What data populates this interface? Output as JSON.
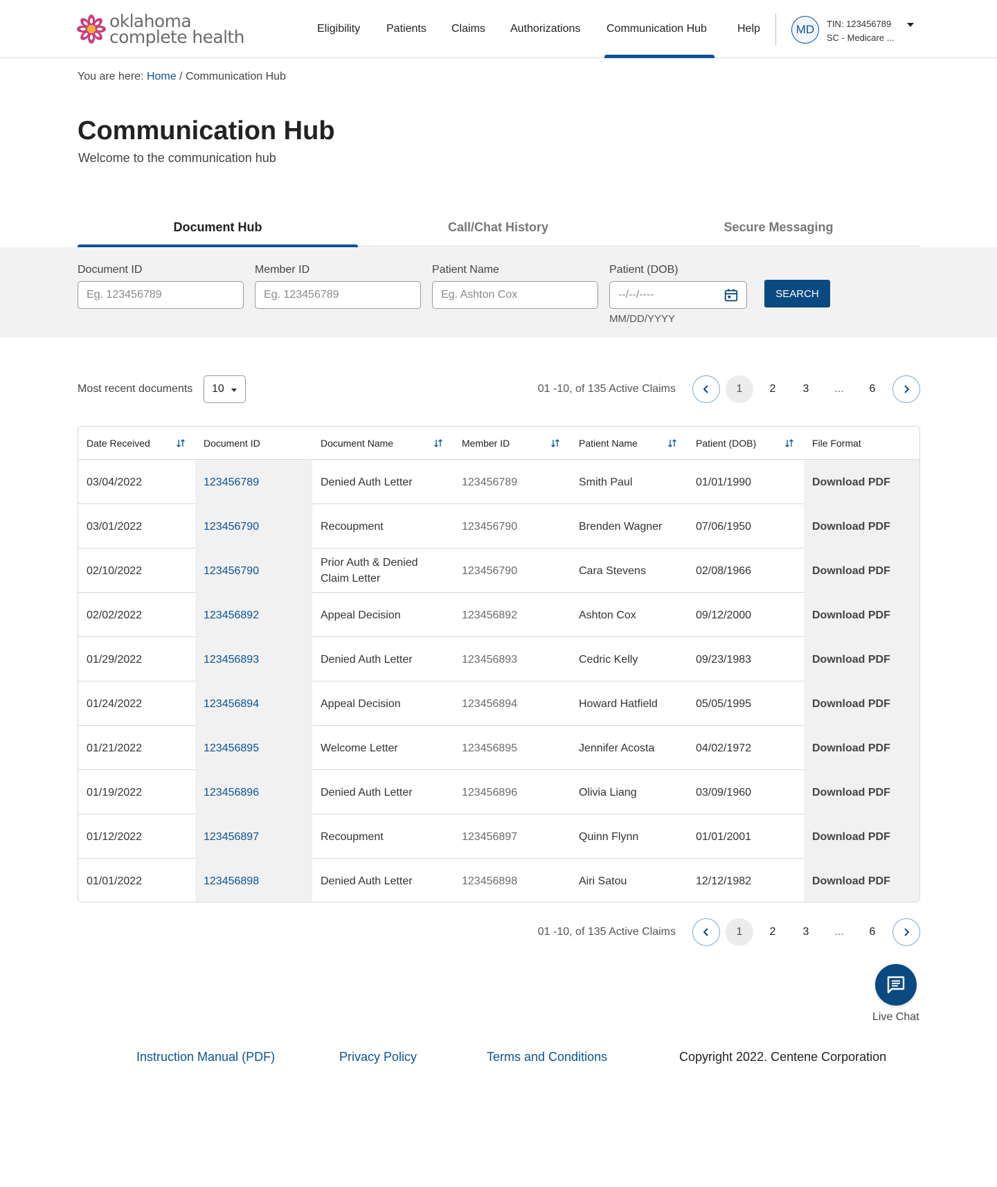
{
  "brand": {
    "line1": "oklahoma",
    "line2": "complete health",
    "colors": {
      "petal": "#c8407d",
      "center": "#f2b12b",
      "primary": "#0b5394",
      "button": "#0b4a80"
    }
  },
  "nav": {
    "items": [
      {
        "label": "Eligibility"
      },
      {
        "label": "Patients"
      },
      {
        "label": "Claims"
      },
      {
        "label": "Authorizations"
      },
      {
        "label": "Communication Hub",
        "active": true
      },
      {
        "label": "Help"
      }
    ],
    "account": {
      "initials": "MD",
      "tin": "TIN: 123456789",
      "plan": "SC - Medicare ..."
    }
  },
  "breadcrumb": {
    "prefix": "You are here:",
    "home": "Home",
    "separator": "/",
    "current": "Communication Hub"
  },
  "page": {
    "title": "Communication Hub",
    "subtitle": "Welcome to the communication hub"
  },
  "tabs": [
    {
      "label": "Document Hub",
      "active": true
    },
    {
      "label": "Call/Chat History",
      "active": false
    },
    {
      "label": "Secure Messaging",
      "active": false
    }
  ],
  "filters": {
    "document_id": {
      "label": "Document ID",
      "placeholder": "Eg. 123456789",
      "value": ""
    },
    "member_id": {
      "label": "Member ID",
      "placeholder": "Eg. 123456789",
      "value": ""
    },
    "patient_name": {
      "label": "Patient Name",
      "placeholder": "Eg. Ashton Cox",
      "value": ""
    },
    "patient_dob": {
      "label": "Patient (DOB)",
      "placeholder": "--/--/----",
      "hint": "MM/DD/YYYY",
      "value": ""
    },
    "search_label": "SEARCH"
  },
  "pagination": {
    "recent_label": "Most recent documents",
    "page_size": "10",
    "range_text": "01 -10, of 135 Active Claims",
    "pages": [
      "1",
      "2",
      "3",
      "...",
      "6"
    ],
    "current_page": "1"
  },
  "table": {
    "headers": [
      {
        "label": "Date Received",
        "sortable": true
      },
      {
        "label": "Document ID",
        "sortable": false
      },
      {
        "label": "Document Name",
        "sortable": true
      },
      {
        "label": "Member ID",
        "sortable": true
      },
      {
        "label": "Patient Name",
        "sortable": true
      },
      {
        "label": "Patient (DOB)",
        "sortable": true
      },
      {
        "label": "File Format",
        "sortable": false
      }
    ],
    "rows": [
      {
        "date": "03/04/2022",
        "doc_id": "123456789",
        "doc_name": "Denied Auth Letter",
        "member_id": "123456789",
        "patient": "Smith Paul",
        "dob": "01/01/1990",
        "format": "Download PDF"
      },
      {
        "date": "03/01/2022",
        "doc_id": "123456790",
        "doc_name": "Recoupment",
        "member_id": "123456790",
        "patient": "Brenden Wagner",
        "dob": "07/06/1950",
        "format": "Download PDF"
      },
      {
        "date": "02/10/2022",
        "doc_id": "123456790",
        "doc_name": "Prior Auth & Denied Claim Letter",
        "member_id": "123456790",
        "patient": "Cara Stevens",
        "dob": "02/08/1966",
        "format": "Download PDF"
      },
      {
        "date": "02/02/2022",
        "doc_id": "123456892",
        "doc_name": "Appeal Decision",
        "member_id": "123456892",
        "patient": "Ashton Cox",
        "dob": "09/12/2000",
        "format": "Download PDF"
      },
      {
        "date": "01/29/2022",
        "doc_id": "123456893",
        "doc_name": "Denied Auth Letter",
        "member_id": "123456893",
        "patient": "Cedric Kelly",
        "dob": "09/23/1983",
        "format": "Download PDF"
      },
      {
        "date": "01/24/2022",
        "doc_id": "123456894",
        "doc_name": "Appeal Decision",
        "member_id": "123456894",
        "patient": "Howard Hatfield",
        "dob": "05/05/1995",
        "format": "Download PDF"
      },
      {
        "date": "01/21/2022",
        "doc_id": "123456895",
        "doc_name": "Welcome Letter",
        "member_id": "123456895",
        "patient": "Jennifer Acosta",
        "dob": "04/02/1972",
        "format": "Download PDF"
      },
      {
        "date": "01/19/2022",
        "doc_id": "123456896",
        "doc_name": "Denied Auth Letter",
        "member_id": "123456896",
        "patient": "Olivia Liang",
        "dob": "03/09/1960",
        "format": "Download PDF"
      },
      {
        "date": "01/12/2022",
        "doc_id": "123456897",
        "doc_name": "Recoupment",
        "member_id": "123456897",
        "patient": "Quinn Flynn",
        "dob": "01/01/2001",
        "format": "Download PDF"
      },
      {
        "date": "01/01/2022",
        "doc_id": "123456898",
        "doc_name": "Denied Auth Letter",
        "member_id": "123456898",
        "patient": "Airi Satou",
        "dob": "12/12/1982",
        "format": "Download PDF"
      }
    ]
  },
  "chat": {
    "label": "Live Chat",
    "icon": "chat-icon"
  },
  "footer": {
    "links": [
      "Instruction Manual (PDF)",
      "Privacy Policy",
      "Terms and Conditions"
    ],
    "copyright": "Copyright 2022. Centene Corporation"
  }
}
